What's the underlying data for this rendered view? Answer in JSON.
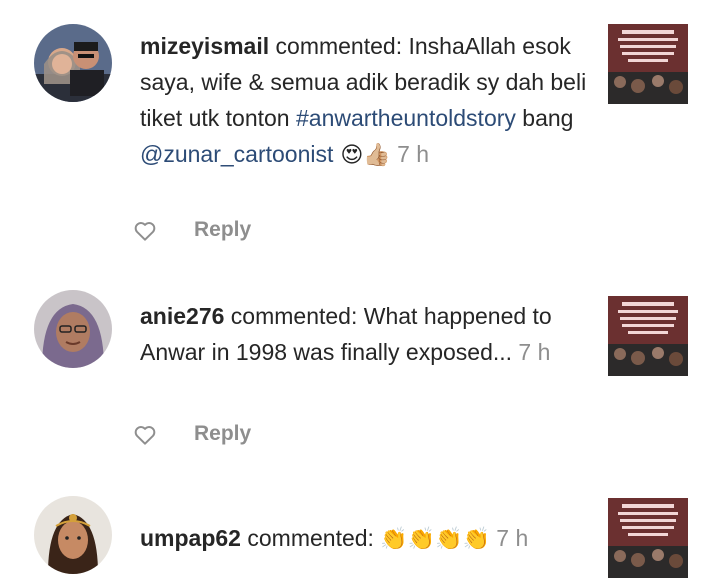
{
  "notifications": [
    {
      "username": "mizeyismail",
      "verb": " commented: ",
      "text_1": "InshaAllah esok saya, wife & semua adik beradik sy dah beli tiket utk tonton ",
      "hashtag": "#anwartheuntoldstory",
      "text_2": " bang ",
      "mention": "@zunar_cartoonist",
      "emojis": " 😍👍🏼",
      "time": " 7 h",
      "reply_label": "Reply"
    },
    {
      "username": "anie276",
      "verb": " commented: ",
      "text_1": "What happened to Anwar in 1998 was finally exposed...",
      "time": " 7 h",
      "reply_label": "Reply"
    },
    {
      "username": "umpap62",
      "verb": " commented: ",
      "emojis": "👏👏👏👏",
      "time": " 7 h"
    }
  ],
  "icons": [
    "heart-icon",
    "post-thumbnail"
  ],
  "colors": {
    "text": "#262626",
    "link": "#2c4b76",
    "muted": "#8e8e8e"
  }
}
